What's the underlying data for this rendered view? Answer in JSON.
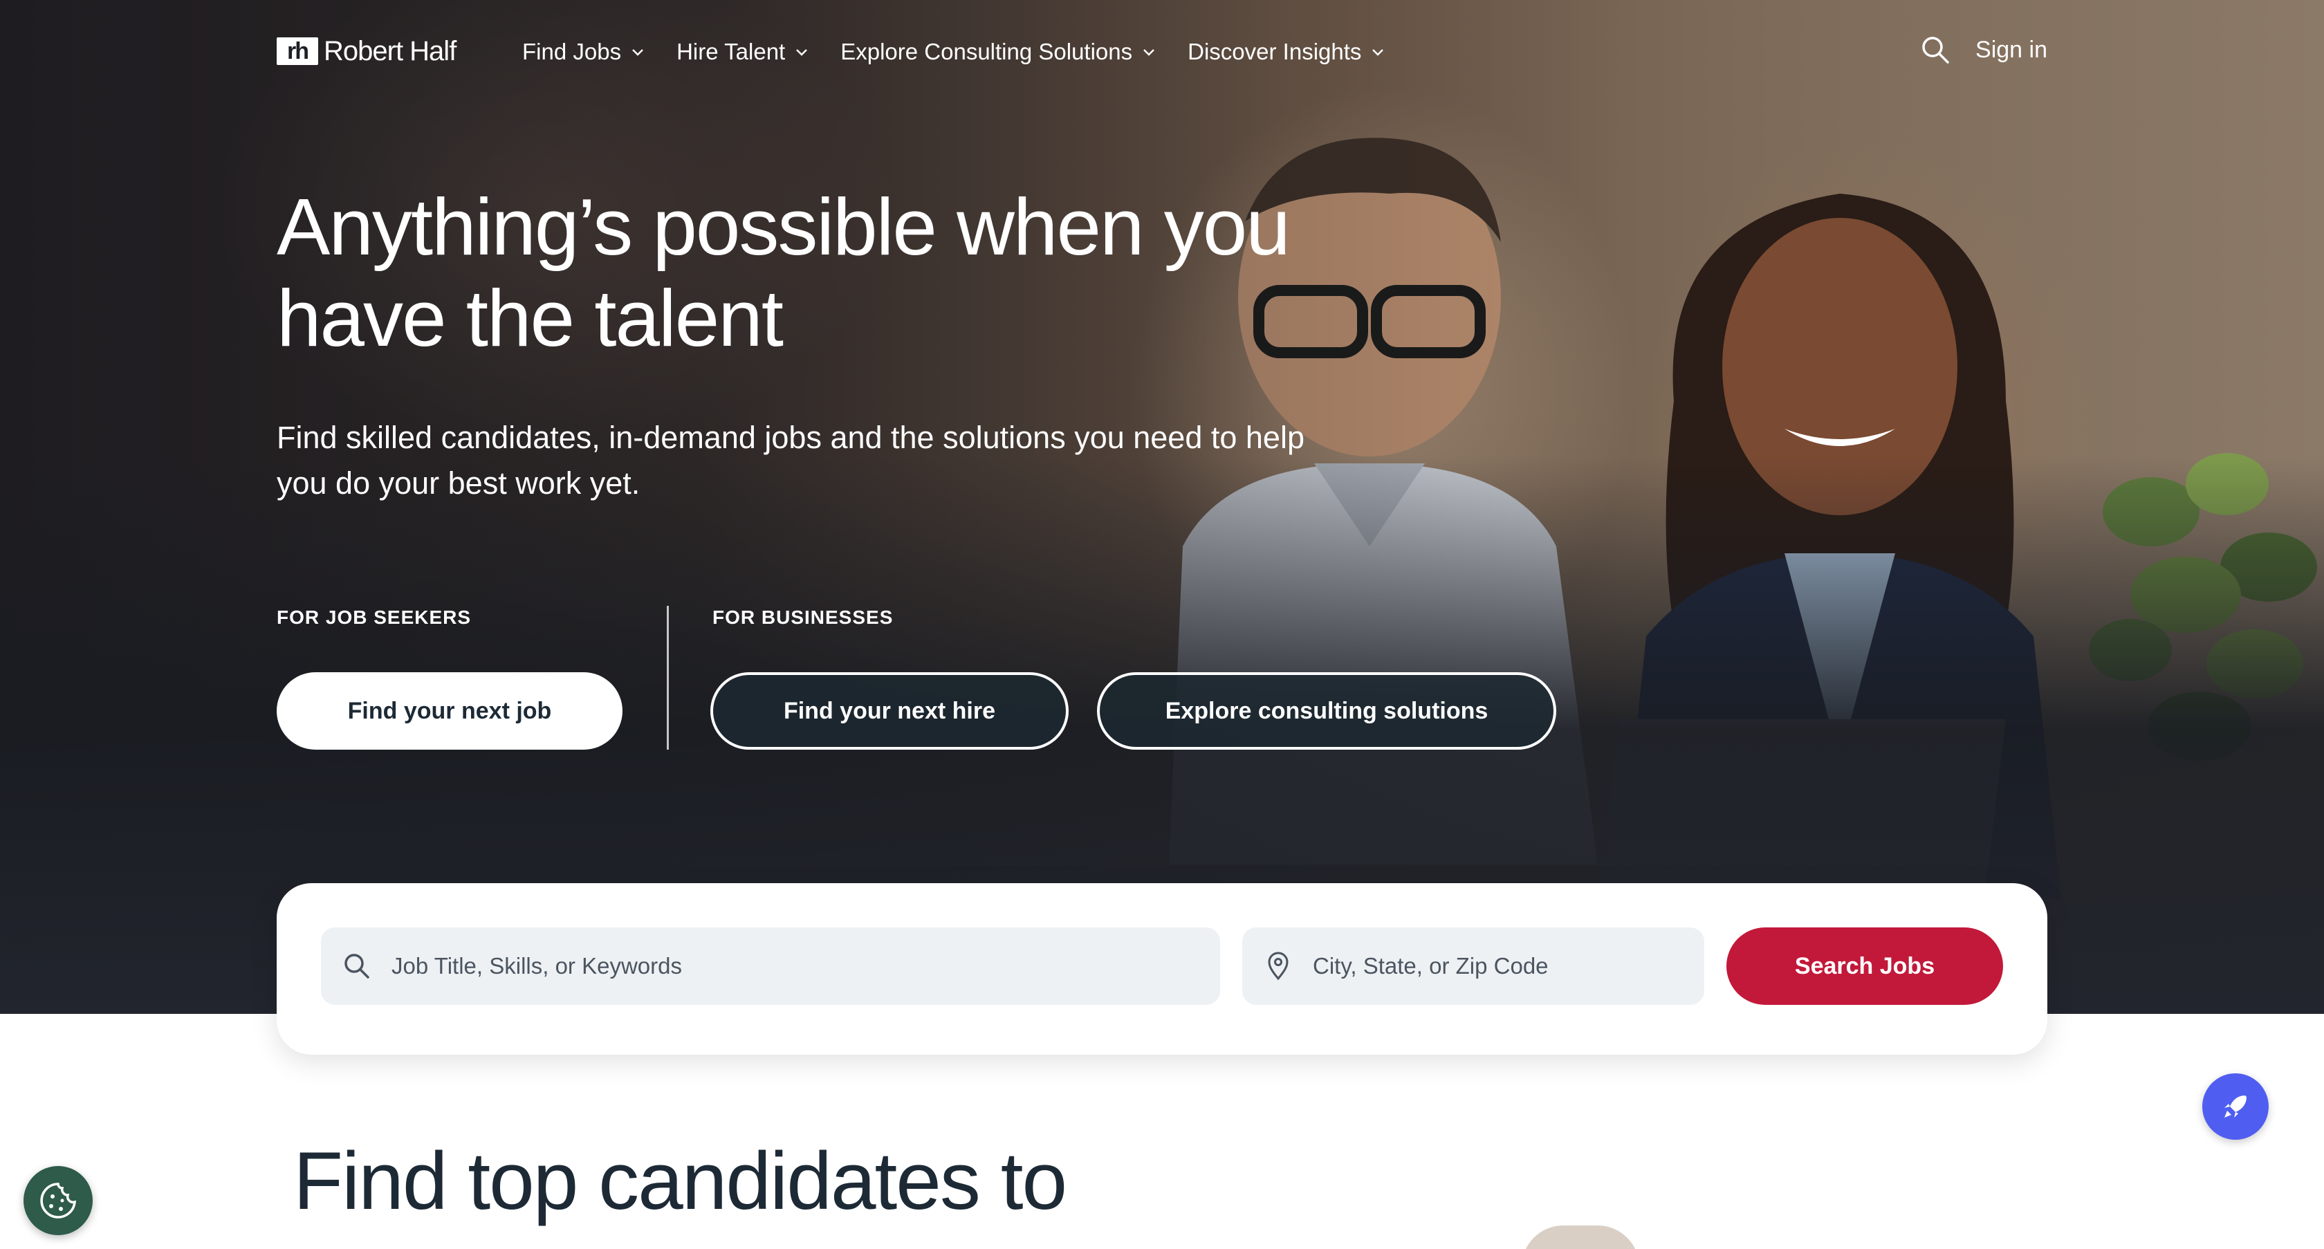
{
  "header": {
    "logo_mark": "rh",
    "logo_text": "Robert Half",
    "nav": [
      {
        "label": "Find Jobs"
      },
      {
        "label": "Hire Talent"
      },
      {
        "label": "Explore Consulting Solutions"
      },
      {
        "label": "Discover Insights"
      }
    ],
    "sign_in": "Sign in"
  },
  "hero": {
    "title": "Anything’s possible when you have the talent",
    "subtitle": "Find skilled candidates, in-demand jobs and the solutions you need to help you do your best work yet.",
    "job_seekers_label": "FOR JOB SEEKERS",
    "businesses_label": "FOR BUSINESSES",
    "btn_find_job": "Find your next job",
    "btn_find_hire": "Find your next hire",
    "btn_consulting": "Explore consulting solutions"
  },
  "search": {
    "keyword_placeholder": "Job Title, Skills, or Keywords",
    "location_placeholder": "City, State, or Zip Code",
    "button": "Search Jobs"
  },
  "below": {
    "title": "Find top candidates to"
  },
  "colors": {
    "accent_red": "#c2193a",
    "rocket_blue": "#4f5ef0",
    "cookie_green": "#2e5b4a"
  },
  "icons": [
    "search-icon",
    "chevron-down-icon",
    "location-pin-icon",
    "rocket-icon",
    "cookie-icon"
  ]
}
